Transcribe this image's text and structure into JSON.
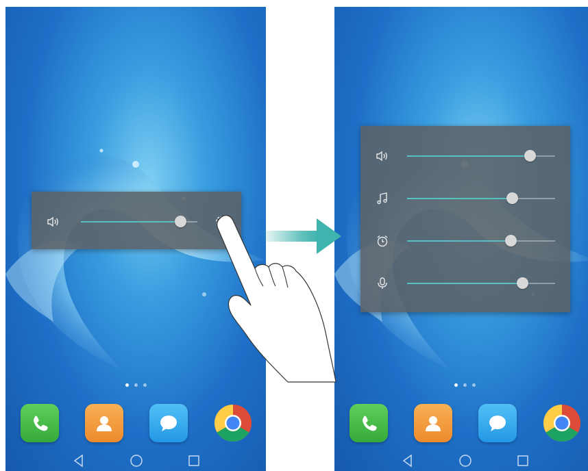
{
  "left_screen": {
    "volume_panel": {
      "sliders": [
        {
          "icon": "speaker-icon",
          "level": 0.85
        }
      ],
      "settings_icon": "gear-icon"
    }
  },
  "right_screen": {
    "volume_panel": {
      "sliders": [
        {
          "icon": "speaker-icon",
          "level": 0.83
        },
        {
          "icon": "music-note-icon",
          "level": 0.71
        },
        {
          "icon": "alarm-clock-icon",
          "level": 0.7
        },
        {
          "icon": "microphone-icon",
          "level": 0.78
        }
      ]
    }
  },
  "home_page_indicator": {
    "pages": 3,
    "active_index": 0
  },
  "dock_apps": [
    "phone-icon",
    "contacts-icon",
    "messages-icon",
    "chrome-icon"
  ],
  "nav_buttons": [
    "back-icon",
    "home-icon",
    "recents-icon"
  ],
  "colors": {
    "slider_fill": "#56c0c2",
    "arrow": "#3fb3ad",
    "panel": "#5c6268"
  }
}
